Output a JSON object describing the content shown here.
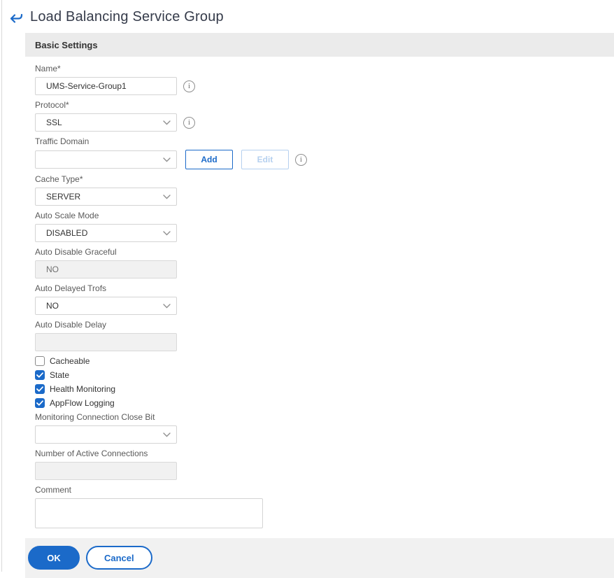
{
  "page": {
    "title": "Load Balancing Service Group"
  },
  "panel": {
    "header": "Basic Settings",
    "fields": {
      "name": {
        "label": "Name*",
        "value": "UMS-Service-Group1"
      },
      "protocol": {
        "label": "Protocol*",
        "value": "SSL"
      },
      "traffic_domain": {
        "label": "Traffic Domain",
        "value": "",
        "add_label": "Add",
        "edit_label": "Edit"
      },
      "cache_type": {
        "label": "Cache Type*",
        "value": "SERVER"
      },
      "auto_scale_mode": {
        "label": "Auto Scale Mode",
        "value": "DISABLED"
      },
      "auto_disable_graceful": {
        "label": "Auto Disable Graceful",
        "value": "NO"
      },
      "auto_delayed_trofs": {
        "label": "Auto Delayed Trofs",
        "value": "NO"
      },
      "auto_disable_delay": {
        "label": "Auto Disable Delay",
        "value": ""
      },
      "monitoring_connection_close_bit": {
        "label": "Monitoring Connection Close Bit",
        "value": ""
      },
      "number_of_active_connections": {
        "label": "Number of Active Connections",
        "value": ""
      },
      "comment": {
        "label": "Comment",
        "value": ""
      }
    },
    "checkboxes": [
      {
        "label": "Cacheable",
        "checked": false
      },
      {
        "label": "State",
        "checked": true
      },
      {
        "label": "Health Monitoring",
        "checked": true
      },
      {
        "label": "AppFlow Logging",
        "checked": true
      }
    ],
    "footer": {
      "ok_label": "OK",
      "cancel_label": "Cancel"
    }
  },
  "colors": {
    "accent_blue": "#1b6ac9",
    "disabled_blue": "#b5d0ef",
    "panel_header_bg": "#ebebeb",
    "panel_footer_bg": "#f1f1f1"
  }
}
